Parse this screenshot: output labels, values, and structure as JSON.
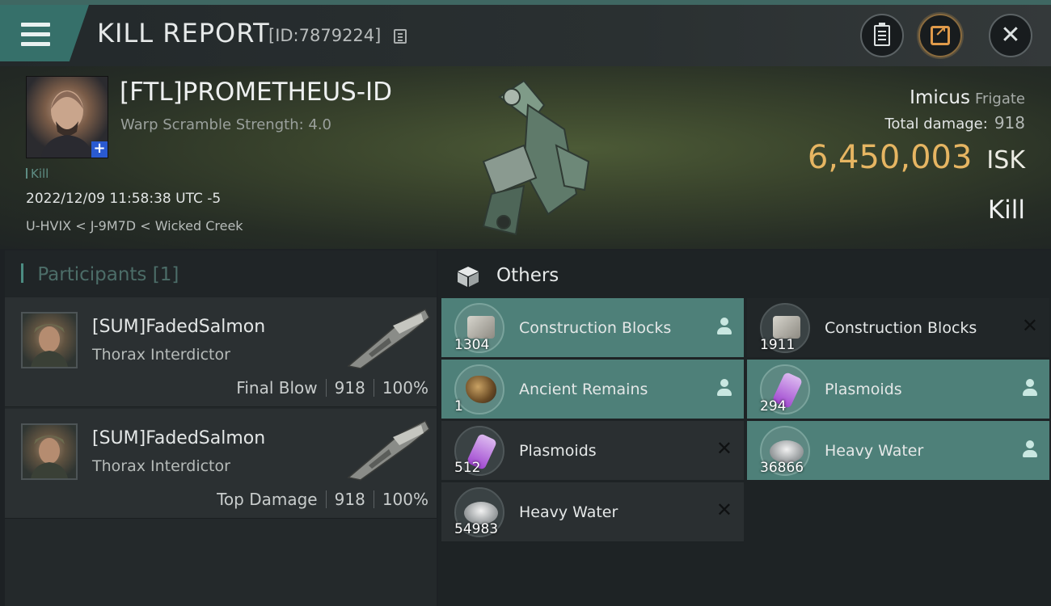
{
  "header": {
    "title": "KILL REPORT",
    "report_id": "[ID:7879224]"
  },
  "victim": {
    "name": "[FTL]PROMETHEUS-ID",
    "subtitle": "Warp Scramble Strength: 4.0",
    "kill_tag": "Kill",
    "datetime": "2022/12/09 11:58:38 UTC -5",
    "location": "U-HVIX < J-9M7D < Wicked Creek",
    "ship_name": "Imicus",
    "ship_class": "Frigate",
    "total_damage_label": "Total damage:",
    "total_damage": "918",
    "isk_value": "6,450,003",
    "isk_unit": "ISK",
    "result": "Kill"
  },
  "participants": {
    "title": "Participants",
    "count": "[1]",
    "rows": [
      {
        "name": "[SUM]FadedSalmon",
        "ship": "Thorax Interdictor",
        "tag": "Final Blow",
        "damage": "918",
        "percent": "100%"
      },
      {
        "name": "[SUM]FadedSalmon",
        "ship": "Thorax Interdictor",
        "tag": "Top Damage",
        "damage": "918",
        "percent": "100%"
      }
    ]
  },
  "others": {
    "title": "Others",
    "items": [
      {
        "name": "Construction Blocks",
        "qty": "1304",
        "status": "dropped",
        "icon": "construction-blocks-icon"
      },
      {
        "name": "Construction Blocks",
        "qty": "1911",
        "status": "destroyed",
        "icon": "construction-blocks-icon"
      },
      {
        "name": "Ancient Remains",
        "qty": "1",
        "status": "dropped",
        "icon": "ancient-remains-icon"
      },
      {
        "name": "Plasmoids",
        "qty": "294",
        "status": "dropped",
        "icon": "plasmoids-icon"
      },
      {
        "name": "Plasmoids",
        "qty": "512",
        "status": "destroyed",
        "icon": "plasmoids-icon"
      },
      {
        "name": "Heavy Water",
        "qty": "36866",
        "status": "dropped",
        "icon": "heavy-water-icon"
      },
      {
        "name": "Heavy Water",
        "qty": "54983",
        "status": "destroyed",
        "icon": "heavy-water-icon"
      }
    ]
  },
  "colors": {
    "accent": "#4e8079",
    "isk": "#e6b562",
    "menu_tab": "#36706a"
  }
}
